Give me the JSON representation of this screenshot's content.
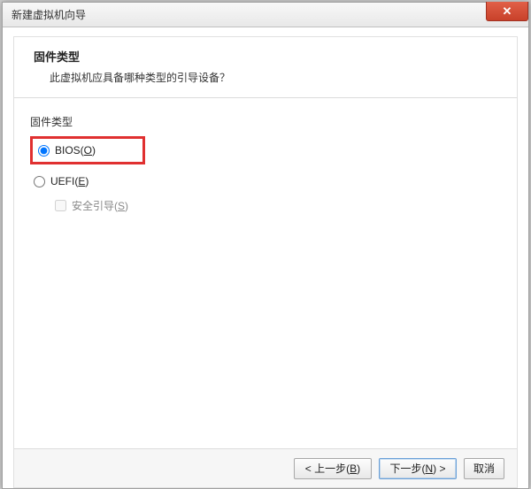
{
  "window": {
    "title": "新建虚拟机向导",
    "close_glyph": "✕"
  },
  "header": {
    "title": "固件类型",
    "subtitle": "此虚拟机应具备哪种类型的引导设备？"
  },
  "section": {
    "label": "固件类型"
  },
  "options": {
    "bios": {
      "label_prefix": "BIOS(",
      "key": "O",
      "label_suffix": ")",
      "selected": true
    },
    "uefi": {
      "label_prefix": "UEFI(",
      "key": "E",
      "label_suffix": ")",
      "selected": false
    },
    "secure_boot": {
      "label_prefix": "安全引导(",
      "key": "S",
      "label_suffix": ")",
      "checked": false,
      "enabled": false
    }
  },
  "buttons": {
    "back": {
      "prefix": "< 上一步(",
      "key": "B",
      "suffix": ")"
    },
    "next": {
      "prefix": "下一步(",
      "key": "N",
      "suffix": ") >"
    },
    "cancel": {
      "label": "取消"
    }
  }
}
